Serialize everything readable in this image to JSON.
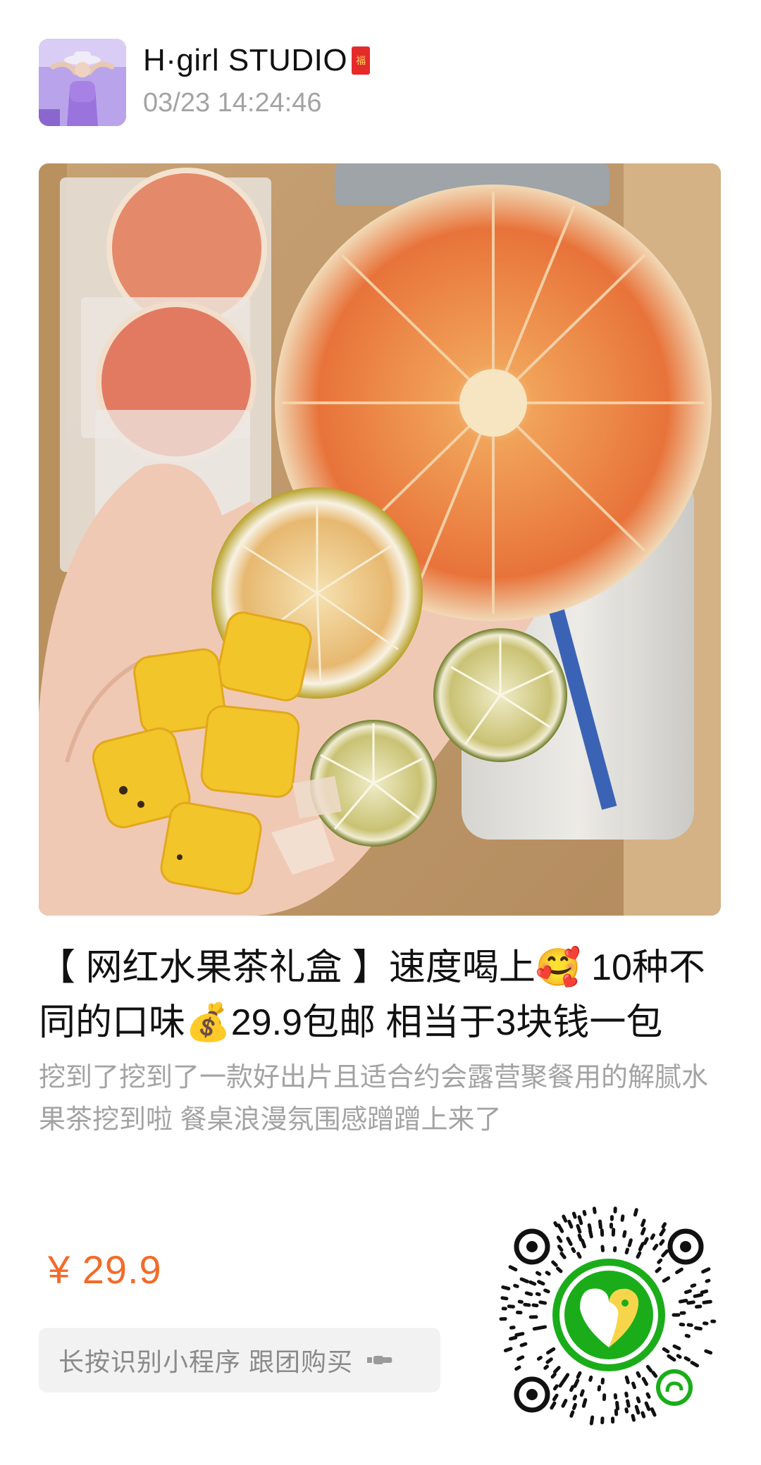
{
  "header": {
    "shop_name": "H·girl STUDIO",
    "badge_glyph": "福",
    "timestamp": "03/23 14:24:46"
  },
  "product": {
    "image_icon": "dried-fruit-tea-photo",
    "title": "【 网红水果茶礼盒 】速度喝上🥰 10种不同的口味💰29.9包邮 相当于3块钱一包",
    "description": "挖到了挖到了一款好出片且适合约会露营聚餐用的解腻水果茶挖到啦 餐桌浪漫氛围感蹭蹭上来了"
  },
  "price": {
    "text": "¥ 29.9",
    "color": "#f26b2a"
  },
  "cta": {
    "label": "长按识别小程序 跟团购买",
    "icon": "pointing-hand-icon"
  },
  "qr": {
    "icon": "mini-program-qr-code",
    "center_color": "#1aad19",
    "logo_color": "#f7d54a"
  }
}
